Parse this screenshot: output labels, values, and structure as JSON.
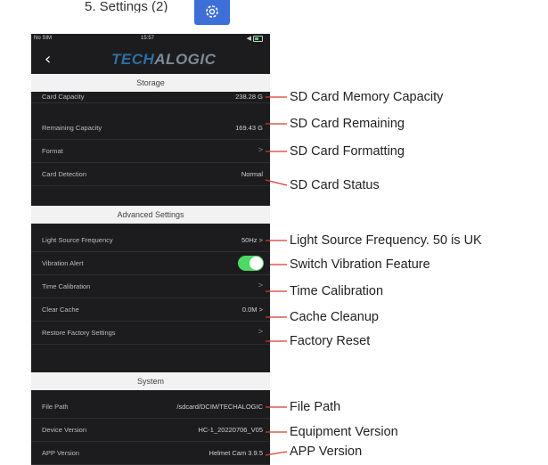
{
  "heading": "5. Settings (2)",
  "status_bar": {
    "carrier": "No SIM",
    "time": "15:57",
    "signal": "◀"
  },
  "brand": {
    "part1": "TECH",
    "part2": "ALOGIC"
  },
  "sections": {
    "storage": "Storage",
    "advanced": "Advanced Settings",
    "system": "System"
  },
  "storage_rows": {
    "card_capacity": {
      "label": "Card Capacity",
      "value": "238.28 G"
    },
    "remaining": {
      "label": "Remaining Capacity",
      "value": "169.43 G"
    },
    "format": {
      "label": "Format",
      "value": ">"
    },
    "detection": {
      "label": "Card Detection",
      "value": "Normal"
    }
  },
  "advanced_rows": {
    "light": {
      "label": "Light Source Frequency",
      "value": "50Hz >"
    },
    "vibration": {
      "label": "Vibration Alert",
      "enabled": true
    },
    "time": {
      "label": "Time Calibration",
      "value": ">"
    },
    "cache": {
      "label": "Clear Cache",
      "value": "0.0M >"
    },
    "factory": {
      "label": "Restore Factory Settings",
      "value": ">"
    }
  },
  "system_rows": {
    "path": {
      "label": "File Path",
      "value": "/sdcard/DCIM/TECHALOGIC"
    },
    "device": {
      "label": "Device Version",
      "value": "HC-1_20220706_V05"
    },
    "app": {
      "label": "APP Version",
      "value": "Helmet Cam 3.9.5"
    }
  },
  "annotations": {
    "sd_capacity": "SD Card Memory Capacity",
    "sd_remaining": "SD Card Remaining",
    "sd_format": "SD Card Formatting",
    "sd_status": "SD Card Status",
    "light": "Light Source Frequency. 50 is UK",
    "vibration": "Switch Vibration Feature",
    "time": "Time Calibration",
    "cache": "Cache Cleanup",
    "factory": "Factory Reset",
    "path": "File Path",
    "version": "Equipment Version",
    "app": "APP Version"
  },
  "colors": {
    "accent_blue": "#3d6fd6",
    "toggle_on": "#4cd964",
    "phone_bg": "#1c1c1e",
    "section_bg": "#f2f2f2"
  }
}
